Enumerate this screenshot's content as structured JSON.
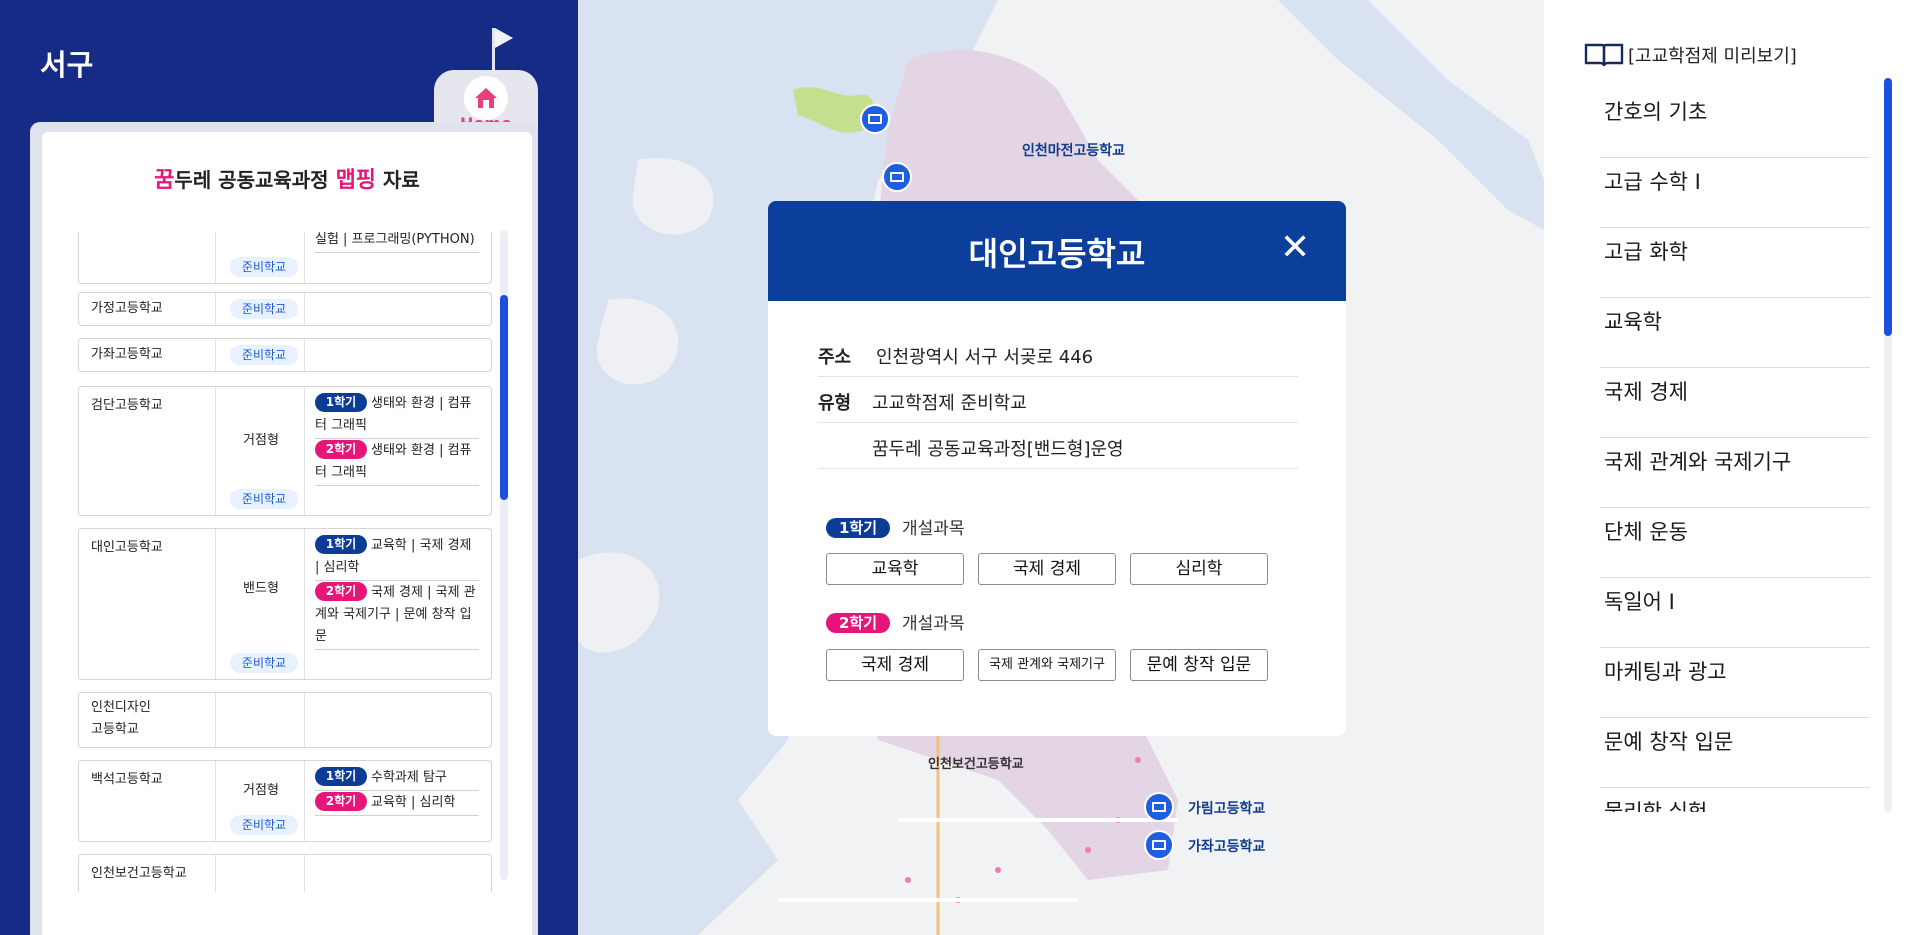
{
  "left": {
    "district": "서구",
    "home_label": "Home",
    "title_pre": "꿈",
    "title_mid": "두레 공동교육과정 ",
    "title_hl": "맵핑",
    "title_post": " 자료",
    "schools": [
      {
        "name": "",
        "type": "",
        "badge": "준비학교",
        "subjects_text": "실험 | 프로그래밍(PYTHON)"
      },
      {
        "name": "가정고등학교",
        "type": "",
        "badge": "준비학교"
      },
      {
        "name": "가좌고등학교",
        "type": "",
        "badge": "준비학교"
      },
      {
        "name": "검단고등학교",
        "type": "거점형",
        "badge": "준비학교",
        "s1_label": "1학기",
        "s1": "생태와 환경 | 컴퓨터 그래픽",
        "s2_label": "2학기",
        "s2": "생태와 환경 | 컴퓨터 그래픽"
      },
      {
        "name": "대인고등학교",
        "type": "밴드형",
        "badge": "준비학교",
        "s1_label": "1학기",
        "s1": "교육학 | 국제 경제 | 심리학",
        "s2_label": "2학기",
        "s2": "국제 경제 | 국제 관계와 국제기구 | 문예 창작 입문"
      },
      {
        "name_line1": "인천디자인",
        "name_line2": "고등학교"
      },
      {
        "name": "백석고등학교",
        "type": "거점형",
        "badge": "준비학교",
        "s1_label": "1학기",
        "s1": "수학과제 탐구",
        "s2_label": "2학기",
        "s2": "교육학 | 심리학"
      },
      {
        "name": "인천보건고등학교"
      }
    ]
  },
  "map": {
    "labels": {
      "majeon": "인천마전고등학교",
      "bogeon": "인천보건고등학교",
      "garim": "가림고등학교",
      "gajwa": "가좌고등학교"
    }
  },
  "modal": {
    "title": "대인고등학교",
    "close_glyph": "✕",
    "address_label": "주소",
    "address_value": "인천광역시 서구 서곶로 446",
    "type_label": "유형",
    "type_value": "고교학점제 준비학교",
    "type_value2": "꿈두레 공동교육과정[밴드형]운영",
    "sem1_label": "1학기",
    "sem2_label": "2학기",
    "open_courses": "개설과목",
    "sem1_courses": [
      "교육학",
      "국제 경제",
      "심리학"
    ],
    "sem2_courses": [
      "국제 경제",
      "국제 관계와 국제기구",
      "문예 창작 입문"
    ]
  },
  "right": {
    "heading": "[고교학점제 미리보기]",
    "courses": [
      "간호의 기초",
      "고급 수학 I",
      "고급 화학",
      "교육학",
      "국제 경제",
      "국제 관계와 국제기구",
      "단체 운동",
      "독일어 I",
      "마케팅과 광고",
      "문예 창작 입문",
      "물리학 실험"
    ]
  },
  "colors": {
    "left_bg": "#162b86",
    "modal_header": "#0c3e9b",
    "accent_pink": "#e5157a",
    "accent_blue": "#1d4fe0",
    "map_district": "#e3d5e4"
  }
}
